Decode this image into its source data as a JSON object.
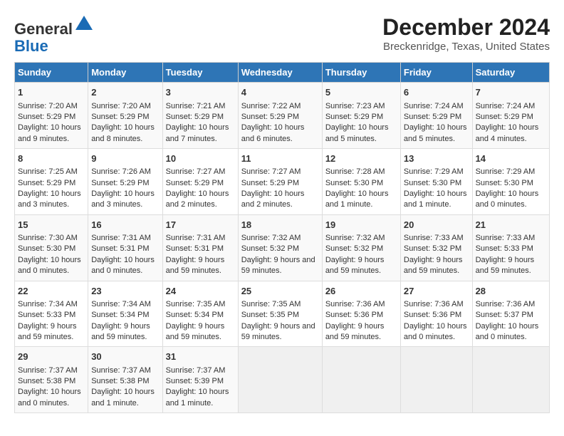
{
  "header": {
    "logo_line1": "General",
    "logo_line2": "Blue",
    "title": "December 2024",
    "subtitle": "Breckenridge, Texas, United States"
  },
  "days_of_week": [
    "Sunday",
    "Monday",
    "Tuesday",
    "Wednesday",
    "Thursday",
    "Friday",
    "Saturday"
  ],
  "weeks": [
    [
      {
        "day": "1",
        "sunrise": "Sunrise: 7:20 AM",
        "sunset": "Sunset: 5:29 PM",
        "daylight": "Daylight: 10 hours and 9 minutes."
      },
      {
        "day": "2",
        "sunrise": "Sunrise: 7:20 AM",
        "sunset": "Sunset: 5:29 PM",
        "daylight": "Daylight: 10 hours and 8 minutes."
      },
      {
        "day": "3",
        "sunrise": "Sunrise: 7:21 AM",
        "sunset": "Sunset: 5:29 PM",
        "daylight": "Daylight: 10 hours and 7 minutes."
      },
      {
        "day": "4",
        "sunrise": "Sunrise: 7:22 AM",
        "sunset": "Sunset: 5:29 PM",
        "daylight": "Daylight: 10 hours and 6 minutes."
      },
      {
        "day": "5",
        "sunrise": "Sunrise: 7:23 AM",
        "sunset": "Sunset: 5:29 PM",
        "daylight": "Daylight: 10 hours and 5 minutes."
      },
      {
        "day": "6",
        "sunrise": "Sunrise: 7:24 AM",
        "sunset": "Sunset: 5:29 PM",
        "daylight": "Daylight: 10 hours and 5 minutes."
      },
      {
        "day": "7",
        "sunrise": "Sunrise: 7:24 AM",
        "sunset": "Sunset: 5:29 PM",
        "daylight": "Daylight: 10 hours and 4 minutes."
      }
    ],
    [
      {
        "day": "8",
        "sunrise": "Sunrise: 7:25 AM",
        "sunset": "Sunset: 5:29 PM",
        "daylight": "Daylight: 10 hours and 3 minutes."
      },
      {
        "day": "9",
        "sunrise": "Sunrise: 7:26 AM",
        "sunset": "Sunset: 5:29 PM",
        "daylight": "Daylight: 10 hours and 3 minutes."
      },
      {
        "day": "10",
        "sunrise": "Sunrise: 7:27 AM",
        "sunset": "Sunset: 5:29 PM",
        "daylight": "Daylight: 10 hours and 2 minutes."
      },
      {
        "day": "11",
        "sunrise": "Sunrise: 7:27 AM",
        "sunset": "Sunset: 5:29 PM",
        "daylight": "Daylight: 10 hours and 2 minutes."
      },
      {
        "day": "12",
        "sunrise": "Sunrise: 7:28 AM",
        "sunset": "Sunset: 5:30 PM",
        "daylight": "Daylight: 10 hours and 1 minute."
      },
      {
        "day": "13",
        "sunrise": "Sunrise: 7:29 AM",
        "sunset": "Sunset: 5:30 PM",
        "daylight": "Daylight: 10 hours and 1 minute."
      },
      {
        "day": "14",
        "sunrise": "Sunrise: 7:29 AM",
        "sunset": "Sunset: 5:30 PM",
        "daylight": "Daylight: 10 hours and 0 minutes."
      }
    ],
    [
      {
        "day": "15",
        "sunrise": "Sunrise: 7:30 AM",
        "sunset": "Sunset: 5:30 PM",
        "daylight": "Daylight: 10 hours and 0 minutes."
      },
      {
        "day": "16",
        "sunrise": "Sunrise: 7:31 AM",
        "sunset": "Sunset: 5:31 PM",
        "daylight": "Daylight: 10 hours and 0 minutes."
      },
      {
        "day": "17",
        "sunrise": "Sunrise: 7:31 AM",
        "sunset": "Sunset: 5:31 PM",
        "daylight": "Daylight: 9 hours and 59 minutes."
      },
      {
        "day": "18",
        "sunrise": "Sunrise: 7:32 AM",
        "sunset": "Sunset: 5:32 PM",
        "daylight": "Daylight: 9 hours and 59 minutes."
      },
      {
        "day": "19",
        "sunrise": "Sunrise: 7:32 AM",
        "sunset": "Sunset: 5:32 PM",
        "daylight": "Daylight: 9 hours and 59 minutes."
      },
      {
        "day": "20",
        "sunrise": "Sunrise: 7:33 AM",
        "sunset": "Sunset: 5:32 PM",
        "daylight": "Daylight: 9 hours and 59 minutes."
      },
      {
        "day": "21",
        "sunrise": "Sunrise: 7:33 AM",
        "sunset": "Sunset: 5:33 PM",
        "daylight": "Daylight: 9 hours and 59 minutes."
      }
    ],
    [
      {
        "day": "22",
        "sunrise": "Sunrise: 7:34 AM",
        "sunset": "Sunset: 5:33 PM",
        "daylight": "Daylight: 9 hours and 59 minutes."
      },
      {
        "day": "23",
        "sunrise": "Sunrise: 7:34 AM",
        "sunset": "Sunset: 5:34 PM",
        "daylight": "Daylight: 9 hours and 59 minutes."
      },
      {
        "day": "24",
        "sunrise": "Sunrise: 7:35 AM",
        "sunset": "Sunset: 5:34 PM",
        "daylight": "Daylight: 9 hours and 59 minutes."
      },
      {
        "day": "25",
        "sunrise": "Sunrise: 7:35 AM",
        "sunset": "Sunset: 5:35 PM",
        "daylight": "Daylight: 9 hours and 59 minutes."
      },
      {
        "day": "26",
        "sunrise": "Sunrise: 7:36 AM",
        "sunset": "Sunset: 5:36 PM",
        "daylight": "Daylight: 9 hours and 59 minutes."
      },
      {
        "day": "27",
        "sunrise": "Sunrise: 7:36 AM",
        "sunset": "Sunset: 5:36 PM",
        "daylight": "Daylight: 10 hours and 0 minutes."
      },
      {
        "day": "28",
        "sunrise": "Sunrise: 7:36 AM",
        "sunset": "Sunset: 5:37 PM",
        "daylight": "Daylight: 10 hours and 0 minutes."
      }
    ],
    [
      {
        "day": "29",
        "sunrise": "Sunrise: 7:37 AM",
        "sunset": "Sunset: 5:38 PM",
        "daylight": "Daylight: 10 hours and 0 minutes."
      },
      {
        "day": "30",
        "sunrise": "Sunrise: 7:37 AM",
        "sunset": "Sunset: 5:38 PM",
        "daylight": "Daylight: 10 hours and 1 minute."
      },
      {
        "day": "31",
        "sunrise": "Sunrise: 7:37 AM",
        "sunset": "Sunset: 5:39 PM",
        "daylight": "Daylight: 10 hours and 1 minute."
      },
      null,
      null,
      null,
      null
    ]
  ]
}
